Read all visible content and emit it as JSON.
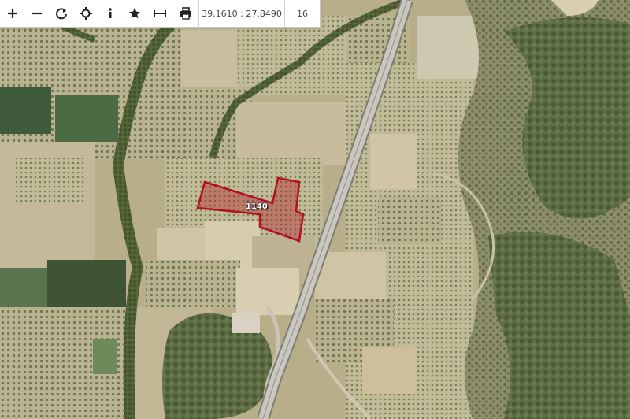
{
  "toolbar": {
    "tools": [
      {
        "icon": "plus-icon",
        "label": "+"
      },
      {
        "icon": "minus-icon",
        "label": "−"
      },
      {
        "icon": "refresh-icon"
      },
      {
        "icon": "crosshair-icon"
      },
      {
        "icon": "info-icon",
        "label": "i"
      },
      {
        "icon": "star-icon"
      },
      {
        "icon": "measure-icon"
      },
      {
        "icon": "print-icon"
      }
    ],
    "coordinates": "39.1610 : 27.8490",
    "zoom_level": "16"
  },
  "map": {
    "parcel_label": "1140",
    "parcel_color": "#b01020",
    "road_color": "#c9c7c0"
  }
}
